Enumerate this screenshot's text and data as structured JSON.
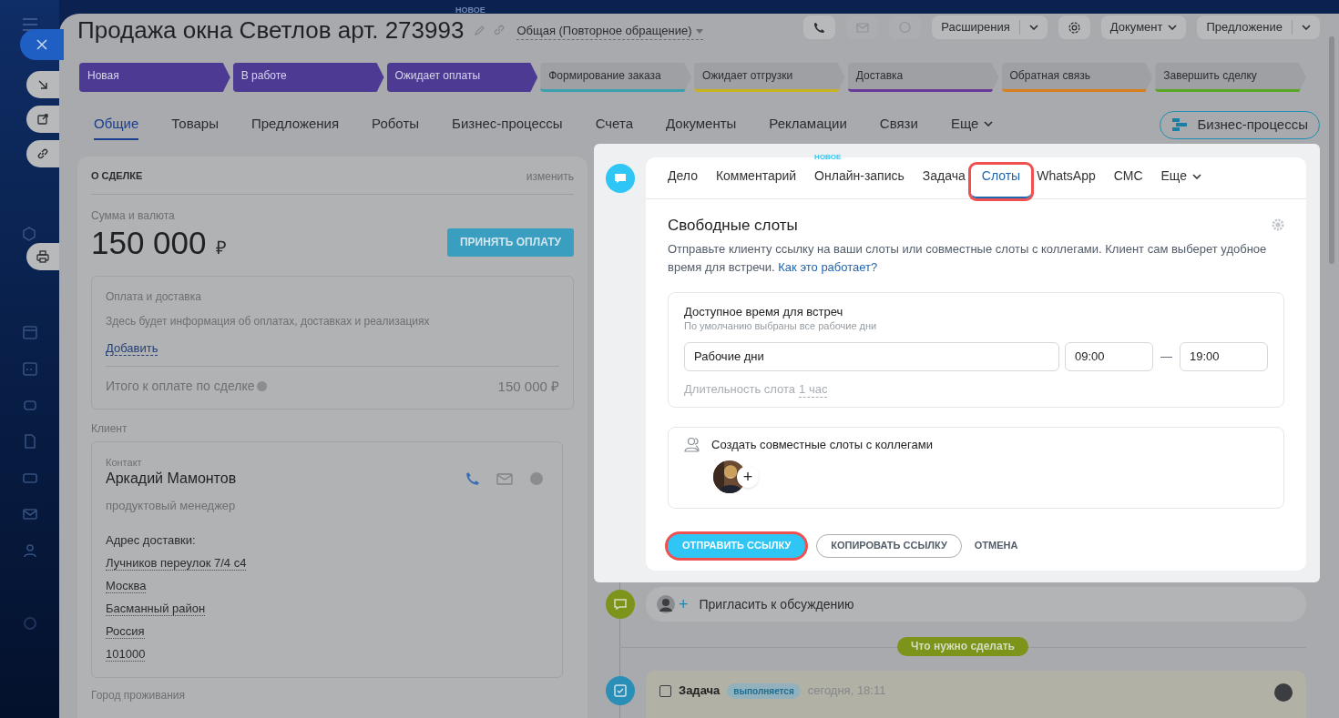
{
  "top_badge": "НОВОЕ",
  "title": "Продажа окна Светлов арт. 273993",
  "category": "Общая (Повторное обращение)",
  "toolbar": [
    {
      "label": "Расширения",
      "kind": "split"
    },
    {
      "label": "Документ",
      "kind": "dropdown"
    },
    {
      "label": "Предложение",
      "kind": "split"
    }
  ],
  "stages": [
    {
      "label": "Новая",
      "passed": true,
      "color": "#4d3a93"
    },
    {
      "label": "В работе",
      "passed": true,
      "color": "#4d3a93"
    },
    {
      "label": "Ожидает оплаты",
      "passed": true,
      "color": "#4d3a93"
    },
    {
      "label": "Формирование заказа",
      "passed": false,
      "color": "#3aa0b0"
    },
    {
      "label": "Ожидает отгрузки",
      "passed": false,
      "color": "#c9b21f"
    },
    {
      "label": "Доставка",
      "passed": false,
      "color": "#6a3a9a"
    },
    {
      "label": "Обратная связь",
      "passed": false,
      "color": "#d9801e"
    },
    {
      "label": "Завершить сделку",
      "passed": false,
      "color": "#5aa626"
    }
  ],
  "tabs": [
    {
      "label": "Общие",
      "selected": true
    },
    {
      "label": "Товары",
      "selected": false
    },
    {
      "label": "Предложения",
      "selected": false
    },
    {
      "label": "Роботы",
      "selected": false
    },
    {
      "label": "Бизнес-процессы",
      "selected": false
    },
    {
      "label": "Счета",
      "selected": false
    },
    {
      "label": "Документы",
      "selected": false
    },
    {
      "label": "Рекламации",
      "selected": false
    },
    {
      "label": "Связи",
      "selected": false
    },
    {
      "label": "Еще",
      "selected": false,
      "kind": "more"
    }
  ],
  "bp_button": "Бизнес-процессы",
  "deal": {
    "heading": "О СДЕЛКЕ",
    "edit": "изменить",
    "amount_label": "Сумма и валюта",
    "amount": "150 000",
    "currency": "₽",
    "pay_button": "ПРИНЯТЬ ОПЛАТУ",
    "payment": {
      "title": "Оплата и доставка",
      "info": "Здесь будет информация об оплатах, доставках и реализациях",
      "add": "Добавить",
      "total_label": "Итого к оплате по сделке",
      "total": "150 000 ₽"
    },
    "client_label": "Клиент",
    "contact": {
      "label": "Контакт",
      "name": "Аркадий Мамонтов",
      "position": "продуктовый менеджер",
      "address_label": "Адрес доставки:",
      "address": [
        "Лучников переулок 7/4 с4",
        "Москва",
        "Басманный район",
        "Россия",
        "101000"
      ]
    },
    "city_label": "Город проживания"
  },
  "composer": {
    "tabs": [
      {
        "label": "Дело",
        "selected": false,
        "highlighted": false
      },
      {
        "label": "Комментарий",
        "selected": false,
        "highlighted": false
      },
      {
        "label": "Онлайн-запись",
        "selected": false,
        "highlighted": false,
        "badge": "НОВОЕ"
      },
      {
        "label": "Задача",
        "selected": false,
        "highlighted": false
      },
      {
        "label": "Слоты",
        "selected": true,
        "highlighted": true
      },
      {
        "label": "WhatsApp",
        "selected": false,
        "highlighted": false
      },
      {
        "label": "СМС",
        "selected": false,
        "highlighted": false
      },
      {
        "label": "Еще",
        "selected": false,
        "highlighted": false,
        "kind": "more"
      }
    ],
    "title": "Свободные слоты",
    "description": "Отправьте клиенту ссылку на ваши слоты или совместные слоты с коллегами. Клиент сам выберет удобное время для встречи.",
    "help_link": "Как это работает?",
    "availability": {
      "title": "Доступное время для встреч",
      "hint": "По умолчанию выбраны все рабочие дни",
      "days": "Рабочие дни",
      "from": "09:00",
      "dash": "—",
      "to": "19:00",
      "duration_label": "Длительность слота",
      "duration": "1 час"
    },
    "colleagues": {
      "title": "Создать совместные слоты с коллегами",
      "add": "+"
    },
    "buttons": [
      {
        "label": "ОТПРАВИТЬ ССЫЛКУ",
        "kind": "primary",
        "highlighted": true
      },
      {
        "label": "КОПИРОВАТЬ ССЫЛКУ",
        "kind": "outline",
        "highlighted": false
      },
      {
        "label": "ОТМЕНА",
        "kind": "text",
        "highlighted": false
      }
    ]
  },
  "invite": {
    "plus": "+",
    "label": "Пригласить к обсуждению"
  },
  "todo_label": "Что нужно сделать",
  "task": {
    "title": "Задача",
    "checked": false,
    "status": "выполняется",
    "time": "сегодня, 18:11"
  }
}
